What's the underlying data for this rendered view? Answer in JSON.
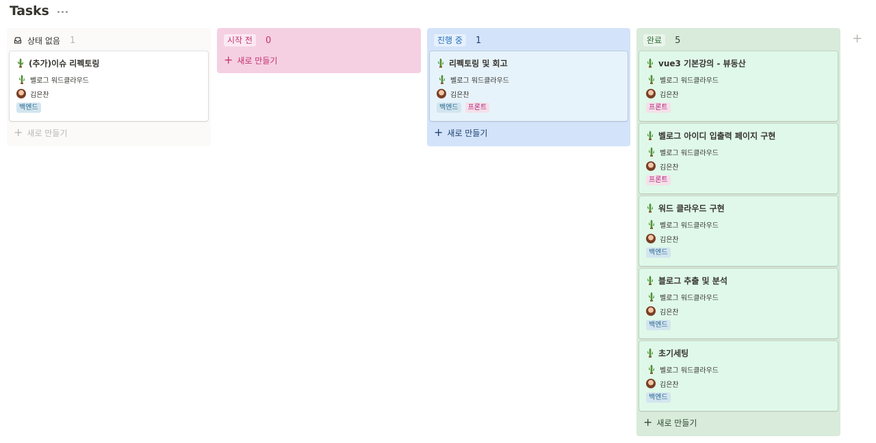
{
  "page": {
    "title": "Tasks"
  },
  "columns": {
    "nostatus": {
      "label": "상태 없음",
      "count": "1",
      "new_label": "새로 만들기",
      "cards": [
        {
          "title": "(추가)이슈 리펙토링",
          "project": "벨로그 워드클라우드",
          "assignee": "김은찬",
          "tags": [
            "백엔드"
          ]
        }
      ]
    },
    "todo": {
      "label": "시작 전",
      "count": "0",
      "new_label": "새로 만들기",
      "cards": []
    },
    "inprogress": {
      "label": "진행 중",
      "count": "1",
      "new_label": "새로 만들기",
      "cards": [
        {
          "title": "리펙토링 및 회고",
          "project": "벨로그 워드클라우드",
          "assignee": "김은찬",
          "tags": [
            "백엔드",
            "프론트"
          ]
        }
      ]
    },
    "done": {
      "label": "완료",
      "count": "5",
      "new_label": "새로 만들기",
      "cards": [
        {
          "title": "vue3 기본강의 - 뷰동산",
          "project": "벨로그 워드클라우드",
          "assignee": "김은찬",
          "tags": [
            "프론트"
          ]
        },
        {
          "title": "벨로그 아이디 입출력 페이지 구현",
          "project": "벨로그 워드클라우드",
          "assignee": "김은찬",
          "tags": [
            "프론트"
          ]
        },
        {
          "title": "워드 클라우드 구현",
          "project": "벨로그 워드클라우드",
          "assignee": "김은찬",
          "tags": [
            "백엔드"
          ]
        },
        {
          "title": "블로그 추출 및 분석",
          "project": "벨로그 워드클라우드",
          "assignee": "김은찬",
          "tags": [
            "백엔드"
          ]
        },
        {
          "title": "초기세팅",
          "project": "벨로그 워드클라우드",
          "assignee": "김은찬",
          "tags": [
            "백엔드"
          ]
        }
      ]
    }
  },
  "add_column_symbol": "+",
  "colors": {
    "nostatus_bg": "#fbfaf9",
    "todo_bg": "#f5d0e2",
    "todo_pill": "#fbe9f2",
    "todo_text": "#c4326f",
    "progress_bg": "#d3e3fa",
    "progress_pill": "#e6f0fd",
    "progress_text": "#1f6fb7",
    "progress_card": "#e7f3fb",
    "done_bg": "#d9ebdb",
    "done_pill": "#e9f5ea",
    "done_text": "#2f6b38",
    "done_card": "#dff8e9"
  }
}
